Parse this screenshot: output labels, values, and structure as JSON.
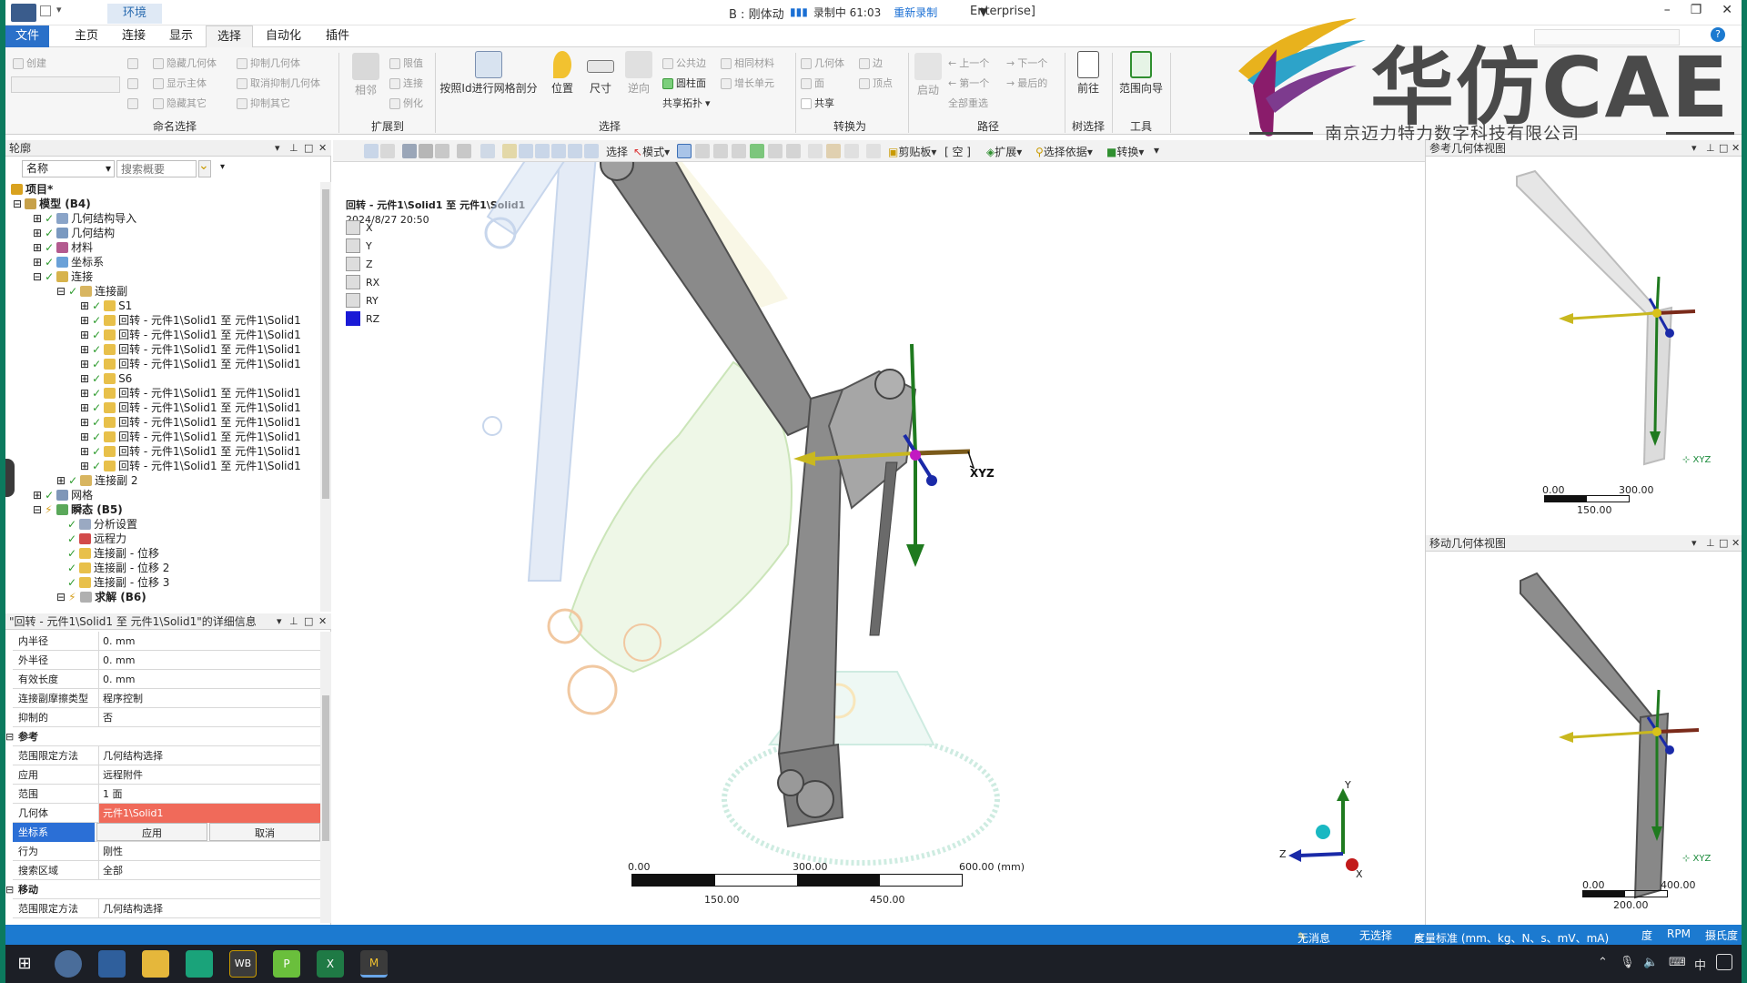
{
  "titlebar": {
    "context_tab": "环境",
    "title": "B : 刚体动",
    "title_suffix": "Enterprise]",
    "recording_status": "录制中 61:03",
    "record_again": "重新录制"
  },
  "tabs": [
    "文件",
    "主页",
    "连接",
    "显示",
    "选择",
    "自动化",
    "插件"
  ],
  "ribbon": {
    "named_selection": {
      "label": "命名选择",
      "create": "创建",
      "hide_body": "隐藏几何体",
      "show_body": "显示主体",
      "hide_others": "隐藏其它",
      "suppress_body": "抑制几何体",
      "unsuppress_body": "取消抑制几何体",
      "suppress_others": "抑制其它"
    },
    "extend": {
      "label": "扩展到",
      "adjacent": "相邻",
      "limit": "限值",
      "connect": "连接",
      "instance": "例化"
    },
    "select": {
      "label": "选择",
      "mesh_id": "按照Id进行网格剖分",
      "location": "位置",
      "size": "尺寸",
      "reverse": "逆向",
      "common_edge": "公共边",
      "cylinder": "圆柱面",
      "same_material": "相同材料",
      "grow_elements": "增长单元",
      "shared_topology": "共享拓扑"
    },
    "convert": {
      "label": "转换为",
      "geometry": "几何体",
      "edge": "边",
      "face": "面",
      "vertex": "顶点",
      "shared": "共享"
    },
    "path": {
      "label": "路径",
      "start": "启动",
      "prev": "上一个",
      "next": "下一个",
      "first": "第一个",
      "last": "最后的",
      "reselect_all": "全部重选"
    },
    "tree_select": {
      "label": "树选择",
      "go_to": "前往"
    },
    "tools": {
      "label": "工具",
      "scope_wizard": "范围向导"
    }
  },
  "watermark": {
    "brand": "华仿CAE",
    "company": "南京迈力特力数字科技有限公司"
  },
  "outline": {
    "title": "轮廓",
    "filter_name": "名称",
    "search_placeholder": "搜索概要",
    "tree": {
      "project": "项目*",
      "model": "模型 (B4)",
      "geometry_import": "几何结构导入",
      "geometry": "几何结构",
      "materials": "材料",
      "coordinate_systems": "坐标系",
      "connections": "连接",
      "joints": "连接副",
      "joint_s1": "S1",
      "joint_revolute": "回转 - 元件1\\Solid1 至 元件1\\Solid1",
      "joint_s6": "S6",
      "joints2": "连接副 2",
      "mesh": "网格",
      "transient": "瞬态 (B5)",
      "analysis_settings": "分析设置",
      "remote_force": "远程力",
      "joint_disp": "连接副 - 位移",
      "joint_disp2": "连接副 - 位移 2",
      "joint_disp3": "连接副 - 位移 3",
      "solution": "求解 (B6)"
    }
  },
  "details": {
    "title": "\"回转 - 元件1\\Solid1 至 元件1\\Solid1\"的详细信息",
    "rows": [
      {
        "k": "内半径",
        "v": "0. mm"
      },
      {
        "k": "外半径",
        "v": "0. mm"
      },
      {
        "k": "有效长度",
        "v": "0. mm"
      },
      {
        "k": "连接副摩擦类型",
        "v": "程序控制"
      },
      {
        "k": "抑制的",
        "v": "否"
      },
      {
        "k": "参考",
        "v": ""
      },
      {
        "k": "范围限定方法",
        "v": "几何结构选择"
      },
      {
        "k": "应用",
        "v": "远程附件"
      },
      {
        "k": "范围",
        "v": "1 面"
      },
      {
        "k": "几何体",
        "v": "元件1\\Solid1"
      },
      {
        "k": "坐标系",
        "v": ""
      },
      {
        "k": "行为",
        "v": "刚性"
      },
      {
        "k": "搜索区域",
        "v": "全部"
      },
      {
        "k": "移动",
        "v": ""
      },
      {
        "k": "范围限定方法",
        "v": "几何结构选择"
      }
    ],
    "apply": "应用",
    "cancel": "取消"
  },
  "viewport": {
    "toolbar": {
      "select": "选择",
      "mode": "模式",
      "clipboard": "剪贴板",
      "empty": "[ 空 ]",
      "expand": "扩展",
      "select_by": "选择依据",
      "convert": "转换"
    },
    "info_line1": "回转 - 元件1\\Solid1 至 元件1\\Solid1",
    "info_line2": "2024/8/27 20:50",
    "legend": [
      "X",
      "Y",
      "Z",
      "RX",
      "RY",
      "RZ"
    ],
    "triad_label": "XYZ",
    "scale": {
      "t0": "0.00",
      "t1": "300.00",
      "t2": "600.00 (mm)",
      "b1": "150.00",
      "b2": "450.00"
    }
  },
  "ref_view": {
    "title": "参考几何体视图",
    "s0": "0.00",
    "s1": "300.00",
    "s2": "150.00"
  },
  "mov_view": {
    "title": "移动几何体视图",
    "s0": "0.00",
    "s1": "400.00",
    "s2": "200.00"
  },
  "statusbar": {
    "messages": "无消息",
    "selection": "无选择",
    "units": "度量标准 (mm、kg、N、s、mV、mA)",
    "deg": "度",
    "rpm": "RPM",
    "temp": "摄氏度"
  },
  "taskbar": {
    "ime": "中"
  },
  "colors": {
    "accent": "#1c7ad0",
    "file_tab": "#2a70c9",
    "highlight": "#f06a5a"
  }
}
